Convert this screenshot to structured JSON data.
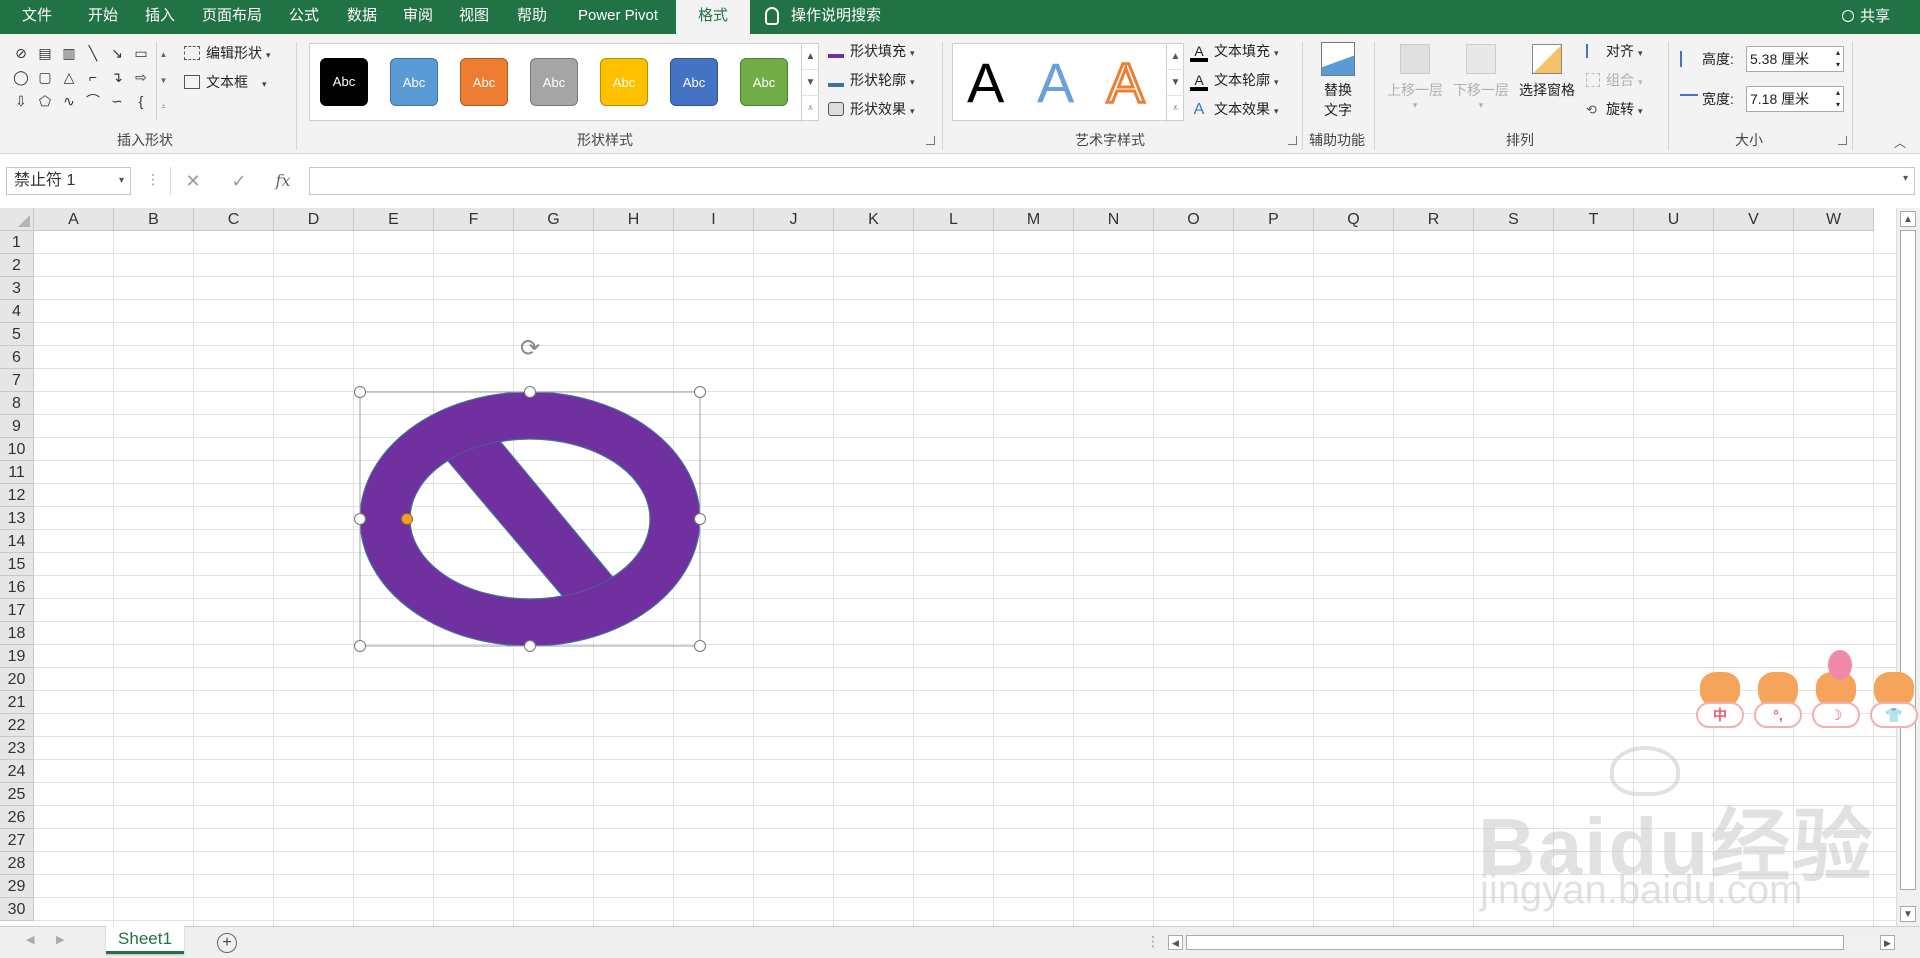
{
  "tabs": [
    {
      "label": "文件",
      "active": false
    },
    {
      "label": "开始",
      "active": false
    },
    {
      "label": "插入",
      "active": false
    },
    {
      "label": "页面布局",
      "active": false
    },
    {
      "label": "公式",
      "active": false
    },
    {
      "label": "数据",
      "active": false
    },
    {
      "label": "审阅",
      "active": false
    },
    {
      "label": "视图",
      "active": false
    },
    {
      "label": "帮助",
      "active": false
    },
    {
      "label": "Power Pivot",
      "active": false
    },
    {
      "label": "格式",
      "active": true
    }
  ],
  "tell_me": "操作说明搜索",
  "share": "共享",
  "ribbon": {
    "insert_shapes": {
      "label": "插入形状",
      "edit_shape": "编辑形状",
      "text_box": "文本框"
    },
    "shape_styles": {
      "label": "形状样式",
      "swatch_text": "Abc",
      "swatches": [
        {
          "color": "#000000"
        },
        {
          "color": "#5b9bd5"
        },
        {
          "color": "#ed7d31"
        },
        {
          "color": "#a5a5a5"
        },
        {
          "color": "#ffc000"
        },
        {
          "color": "#4472c4"
        },
        {
          "color": "#70ad47"
        }
      ],
      "fill": "形状填充",
      "outline": "形状轮廓",
      "effects": "形状效果"
    },
    "wordart": {
      "label": "艺术字样式",
      "letter": "A",
      "fill": "文本填充",
      "outline": "文本轮廓",
      "effects": "文本效果"
    },
    "accessibility": {
      "label": "辅助功能",
      "alt_text_line1": "替换",
      "alt_text_line2": "文字"
    },
    "arrange": {
      "label": "排列",
      "bring_forward": "上移一层",
      "send_backward": "下移一层",
      "selection_pane": "选择窗格",
      "align": "对齐",
      "group": "组合",
      "rotate": "旋转"
    },
    "size": {
      "label": "大小",
      "height_label": "高度:",
      "height_value": "5.38 厘米",
      "width_label": "宽度:",
      "width_value": "7.18 厘米"
    }
  },
  "formula_bar": {
    "name_box": "禁止符 1",
    "fx": "fx",
    "value": ""
  },
  "columns": [
    "A",
    "B",
    "C",
    "D",
    "E",
    "F",
    "G",
    "H",
    "I",
    "J",
    "K",
    "L",
    "M",
    "N",
    "O",
    "P",
    "Q",
    "R",
    "S",
    "T",
    "U",
    "V",
    "W"
  ],
  "rows": [
    "1",
    "2",
    "3",
    "4",
    "5",
    "6",
    "7",
    "8",
    "9",
    "10",
    "11",
    "12",
    "13",
    "14",
    "15",
    "16",
    "17",
    "18",
    "19",
    "20",
    "21",
    "22",
    "23",
    "24",
    "25",
    "26",
    "27",
    "28",
    "29",
    "30"
  ],
  "shape": {
    "name": "禁止符 1",
    "fill_color": "#7030a0",
    "outline_color": "#41719c"
  },
  "sheets": [
    {
      "label": "Sheet1",
      "active": true
    }
  ],
  "watermark": {
    "logo_text": "Baidu经验",
    "url": "jingyan.baidu.com",
    "badges": [
      "中",
      "°,",
      "☽",
      "👕"
    ]
  }
}
